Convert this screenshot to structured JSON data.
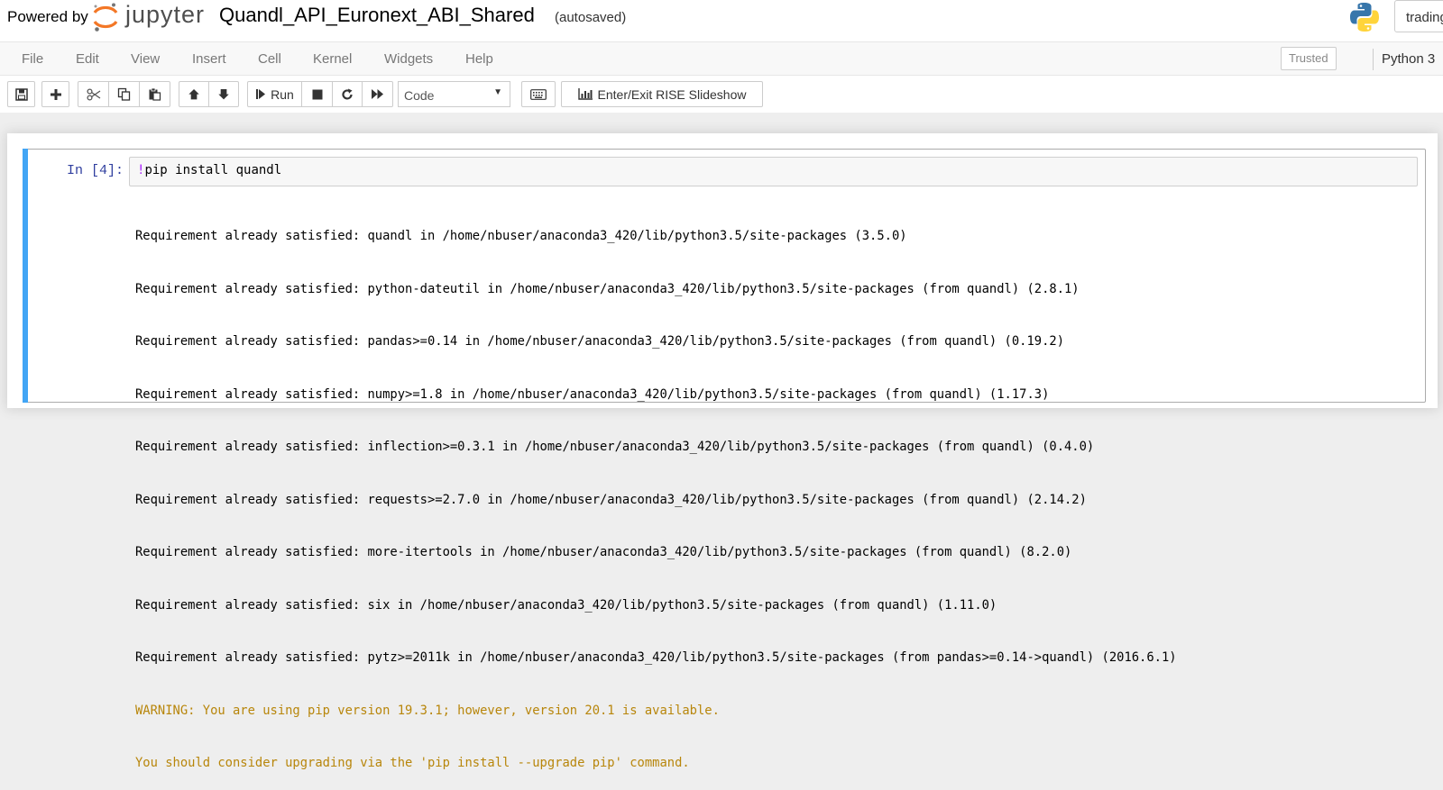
{
  "header": {
    "powered_by": "Powered by",
    "logo_text": "jupyter",
    "notebook_name": "Quandl_API_Euronext_ABI_Shared",
    "autosave_status": "(autosaved)",
    "kernel_name_box": "trading"
  },
  "menubar": {
    "items": [
      "File",
      "Edit",
      "View",
      "Insert",
      "Cell",
      "Kernel",
      "Widgets",
      "Help"
    ],
    "trusted": "Trusted",
    "kernel_indicator": "Python 3"
  },
  "toolbar": {
    "run_label": "Run",
    "cell_type": "Code",
    "rise_label": "Enter/Exit RISE Slideshow"
  },
  "cell": {
    "prompt": "In [4]:",
    "code_bang": "!",
    "code_rest": "pip install quandl",
    "output_lines": [
      "Requirement already satisfied: quandl in /home/nbuser/anaconda3_420/lib/python3.5/site-packages (3.5.0)",
      "Requirement already satisfied: python-dateutil in /home/nbuser/anaconda3_420/lib/python3.5/site-packages (from quandl) (2.8.1)",
      "Requirement already satisfied: pandas>=0.14 in /home/nbuser/anaconda3_420/lib/python3.5/site-packages (from quandl) (0.19.2)",
      "Requirement already satisfied: numpy>=1.8 in /home/nbuser/anaconda3_420/lib/python3.5/site-packages (from quandl) (1.17.3)",
      "Requirement already satisfied: inflection>=0.3.1 in /home/nbuser/anaconda3_420/lib/python3.5/site-packages (from quandl) (0.4.0)",
      "Requirement already satisfied: requests>=2.7.0 in /home/nbuser/anaconda3_420/lib/python3.5/site-packages (from quandl) (2.14.2)",
      "Requirement already satisfied: more-itertools in /home/nbuser/anaconda3_420/lib/python3.5/site-packages (from quandl) (8.2.0)",
      "Requirement already satisfied: six in /home/nbuser/anaconda3_420/lib/python3.5/site-packages (from quandl) (1.11.0)",
      "Requirement already satisfied: pytz>=2011k in /home/nbuser/anaconda3_420/lib/python3.5/site-packages (from pandas>=0.14->quandl) (2016.6.1)"
    ],
    "warning_lines": [
      "WARNING: You are using pip version 19.3.1; however, version 20.1 is available.",
      "You should consider upgrading via the 'pip install --upgrade pip' command."
    ]
  },
  "colors": {
    "cell_selected_bar": "#42a5f5",
    "prompt": "#303f9f",
    "warning_text": "#b8860b",
    "logo_orange": "#f37726"
  }
}
